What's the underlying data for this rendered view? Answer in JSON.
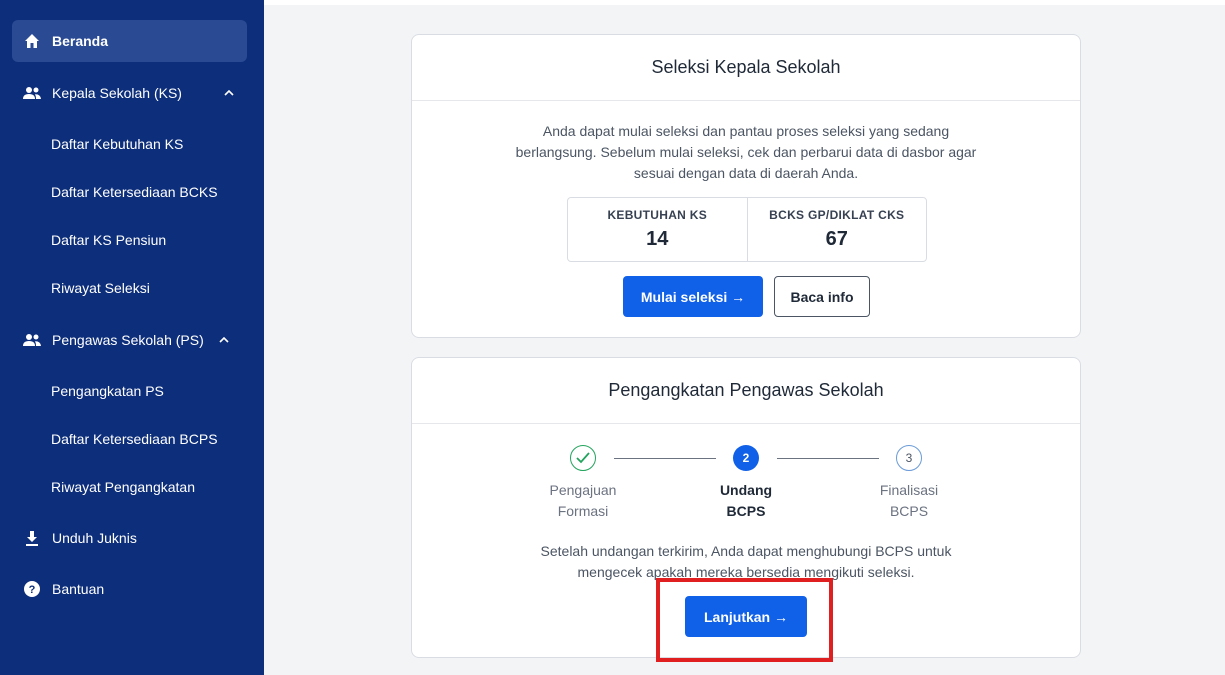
{
  "sidebar": {
    "items": [
      {
        "label": "Beranda",
        "icon": "home-icon"
      },
      {
        "label": "Kepala Sekolah (KS)",
        "icon": "users-icon"
      },
      {
        "label": "Pengawas Sekolah (PS)",
        "icon": "users-icon"
      },
      {
        "label": "Unduh Juknis",
        "icon": "download-icon"
      },
      {
        "label": "Bantuan",
        "icon": "help-icon"
      }
    ],
    "ks_sub": [
      "Daftar Kebutuhan KS",
      "Daftar Ketersediaan BCKS",
      "Daftar KS Pensiun",
      "Riwayat Seleksi"
    ],
    "ps_sub": [
      "Pengangkatan PS",
      "Daftar Ketersediaan BCPS",
      "Riwayat Pengangkatan"
    ]
  },
  "seleksi": {
    "title": "Seleksi Kepala Sekolah",
    "desc_lines": [
      "Anda dapat mulai seleksi dan pantau proses seleksi yang sedang",
      "berlangsung. Sebelum mulai seleksi, cek dan perbarui data di dasbor agar",
      "sesuai dengan data di daerah Anda."
    ],
    "stats": [
      {
        "label": "KEBUTUHAN KS",
        "value": "14"
      },
      {
        "label": "BCKS GP/DIKLAT CKS",
        "value": "67"
      }
    ],
    "start_button": "Mulai seleksi →",
    "info_button": "Baca info"
  },
  "pengangkatan": {
    "title": "Pengangkatan Pengawas Sekolah",
    "steps": [
      {
        "number": "",
        "line1": "Pengajuan",
        "line2": "Formasi",
        "state": "done"
      },
      {
        "number": "2",
        "line1": "Undang",
        "line2": "BCPS",
        "state": "active"
      },
      {
        "number": "3",
        "line1": "Finalisasi",
        "line2": "BCPS",
        "state": "pending"
      }
    ],
    "desc_lines": [
      "Setelah undangan terkirim, Anda dapat menghubungi BCPS untuk",
      "mengecek apakah mereka bersedia mengikuti seleksi."
    ],
    "continue_button": "Lanjutkan →"
  },
  "colors": {
    "sidebar_bg": "#0d2e7a",
    "primary": "#1060e8",
    "success": "#22a45d",
    "highlight": "#e02020"
  }
}
